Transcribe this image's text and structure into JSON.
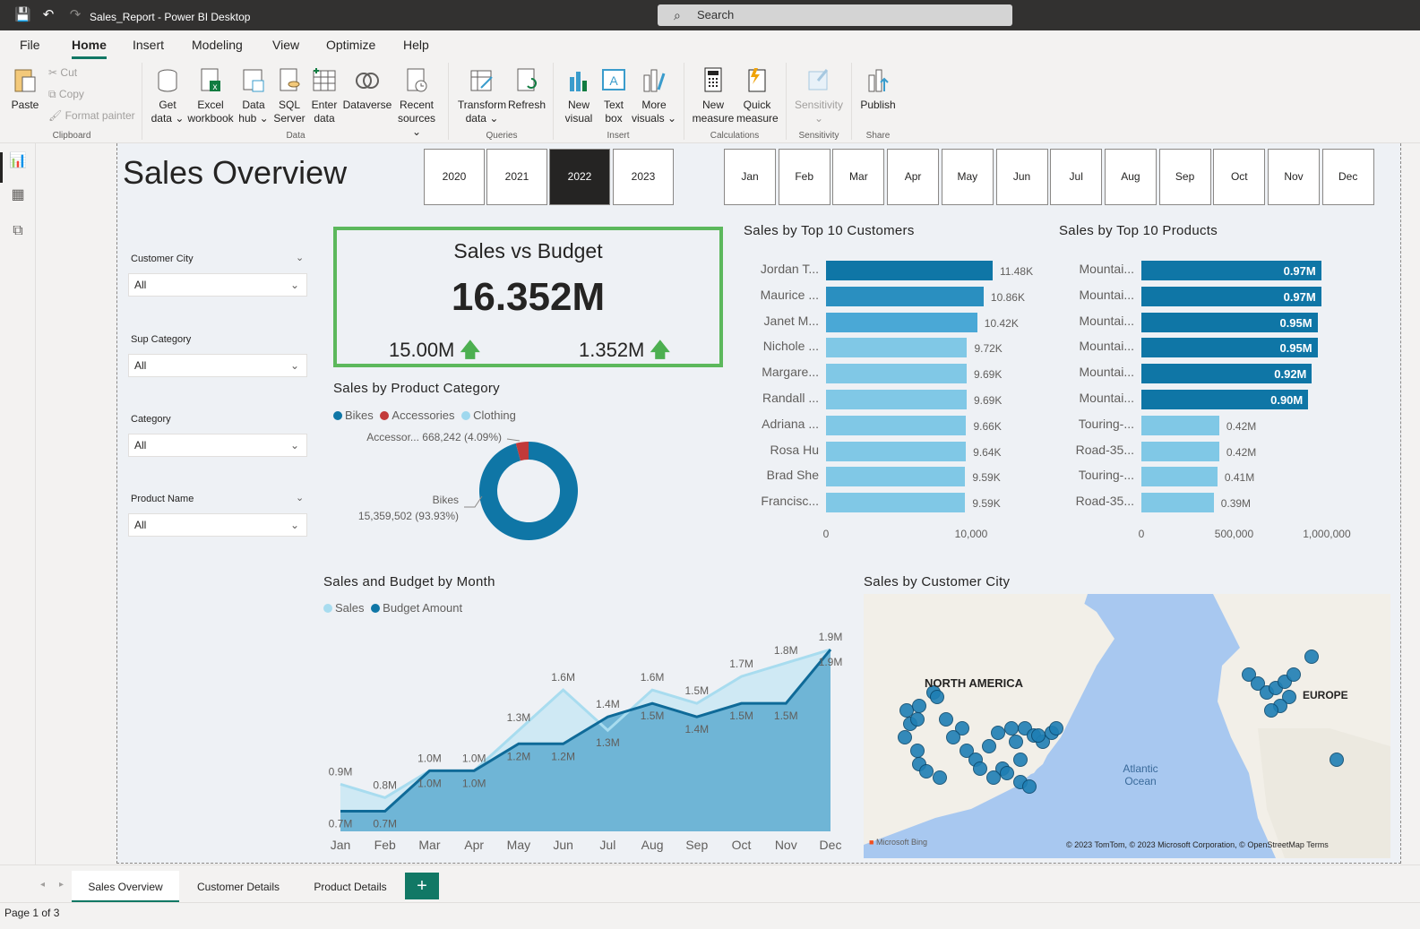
{
  "titlebar": {
    "app_title": "Sales_Report - Power BI Desktop",
    "search_placeholder": "Search"
  },
  "menu": [
    "File",
    "Home",
    "Insert",
    "Modeling",
    "View",
    "Optimize",
    "Help"
  ],
  "ribbon": {
    "paste": "Paste",
    "cut": "Cut",
    "copy": "Copy",
    "format_painter": "Format painter",
    "group_clipboard": "Clipboard",
    "get_data": "Get data",
    "excel": "Excel workbook",
    "data_hub": "Data hub",
    "sql": "SQL Server",
    "enter_data": "Enter data",
    "dataverse": "Dataverse",
    "recent": "Recent sources",
    "group_data": "Data",
    "transform": "Transform data",
    "refresh": "Refresh",
    "group_queries": "Queries",
    "new_visual": "New visual",
    "text_box": "Text box",
    "more_visuals": "More visuals",
    "group_insert": "Insert",
    "new_measure": "New measure",
    "quick_measure": "Quick measure",
    "group_calculations": "Calculations",
    "sensitivity": "Sensitivity",
    "group_sensitivity": "Sensitivity",
    "publish": "Publish",
    "group_share": "Share"
  },
  "report": {
    "title": "Sales Overview",
    "years": [
      "2020",
      "2021",
      "2022",
      "2023"
    ],
    "selected_year": "2022",
    "months": [
      "Jan",
      "Feb",
      "Mar",
      "Apr",
      "May",
      "Jun",
      "Jul",
      "Aug",
      "Sep",
      "Oct",
      "Nov",
      "Dec"
    ],
    "slicers": [
      {
        "label": "Customer City",
        "value": "All"
      },
      {
        "label": "Sup Category",
        "value": "All"
      },
      {
        "label": "Category",
        "value": "All"
      },
      {
        "label": "Product Name",
        "value": "All"
      }
    ],
    "kpi": {
      "title": "Sales vs Budget",
      "value": "16.352M",
      "left": "15.00M",
      "right": "1.352M"
    }
  },
  "chart_data": [
    {
      "type": "bar",
      "orientation": "horizontal",
      "title": "Sales by Top 10 Customers",
      "categories": [
        "Jordan T...",
        "Maurice ...",
        "Janet M...",
        "Nichole ...",
        "Margare...",
        "Randall ...",
        "Adriana ...",
        "Rosa Hu",
        "Brad She",
        "Francisc..."
      ],
      "values": [
        11480,
        10860,
        10420,
        9720,
        9690,
        9690,
        9660,
        9640,
        9590,
        9590
      ],
      "value_labels": [
        "11.48K",
        "10.86K",
        "10.42K",
        "9.72K",
        "9.69K",
        "9.69K",
        "9.66K",
        "9.64K",
        "9.59K",
        "9.59K"
      ],
      "x_ticks": [
        "0",
        "10,000"
      ],
      "xlim": [
        0,
        20000
      ]
    },
    {
      "type": "bar",
      "orientation": "horizontal",
      "title": "Sales by Top 10 Products",
      "categories": [
        "Mountai...",
        "Mountai...",
        "Mountai...",
        "Mountai...",
        "Mountai...",
        "Mountai...",
        "Touring-...",
        "Road-35...",
        "Touring-...",
        "Road-35..."
      ],
      "values": [
        0.97,
        0.97,
        0.95,
        0.95,
        0.92,
        0.9,
        0.42,
        0.42,
        0.41,
        0.39
      ],
      "value_labels": [
        "0.97M",
        "0.97M",
        "0.95M",
        "0.95M",
        "0.92M",
        "0.90M",
        "0.42M",
        "0.42M",
        "0.41M",
        "0.39M"
      ],
      "x_ticks": [
        "0",
        "500,000",
        "1,000,000"
      ],
      "xlim": [
        0,
        1150000
      ]
    },
    {
      "type": "pie",
      "donut": true,
      "title": "Sales by Product Category",
      "legend": [
        "Bikes",
        "Accessories",
        "Clothing"
      ],
      "values": [
        15359502,
        668242,
        0
      ],
      "labels": [
        "Bikes 15,359,502 (93.93%)",
        "Accessor... 668,242 (4.09%)"
      ],
      "colors": [
        "#0f76a6",
        "#c23a3a",
        "#9fd8ee"
      ]
    },
    {
      "type": "area",
      "title": "Sales and Budget by Month",
      "legend": [
        "Sales",
        "Budget Amount"
      ],
      "categories": [
        "Jan",
        "Feb",
        "Mar",
        "Apr",
        "May",
        "Jun",
        "Jul",
        "Aug",
        "Sep",
        "Oct",
        "Nov",
        "Dec"
      ],
      "series": [
        {
          "name": "Sales",
          "values": [
            0.9,
            0.8,
            1.0,
            1.0,
            1.3,
            1.6,
            1.3,
            1.6,
            1.5,
            1.7,
            1.8,
            1.9
          ],
          "labels": [
            "0.9M",
            "0.8M",
            "1.0M",
            "1.0M",
            "1.3M",
            "1.6M",
            "1.3M",
            "1.6M",
            "1.5M",
            "1.7M",
            "1.8M",
            "1.9M"
          ]
        },
        {
          "name": "Budget Amount",
          "values": [
            0.7,
            0.7,
            1.0,
            1.0,
            1.2,
            1.2,
            1.4,
            1.5,
            1.4,
            1.5,
            1.5,
            1.9
          ],
          "labels": [
            "0.7M",
            "0.7M",
            "1.0M",
            "1.0M",
            "1.2M",
            "1.2M",
            "1.4M",
            "1.5M",
            "1.4M",
            "1.5M",
            "1.5M",
            "1.9M"
          ]
        }
      ],
      "ylim": [
        0.55,
        2.0
      ]
    }
  ],
  "map": {
    "title": "Sales by Customer City",
    "label_na": "NORTH AMERICA",
    "label_eu": "EUROPE",
    "label_ocean": "Atlantic Ocean",
    "bing": "Microsoft Bing",
    "copyright": "© 2023 TomTom, © 2023 Microsoft Corporation, © OpenStreetMap Terms"
  },
  "tabs": [
    "Sales Overview",
    "Customer Details",
    "Product Details"
  ],
  "status": "Page 1 of 3",
  "colors": {
    "dark_bar": "#0f76a6",
    "mid_bar": "#3a9ccc",
    "light_bar": "#80c8e6",
    "accent": "#117865",
    "kpi_border": "#5cb85c"
  }
}
